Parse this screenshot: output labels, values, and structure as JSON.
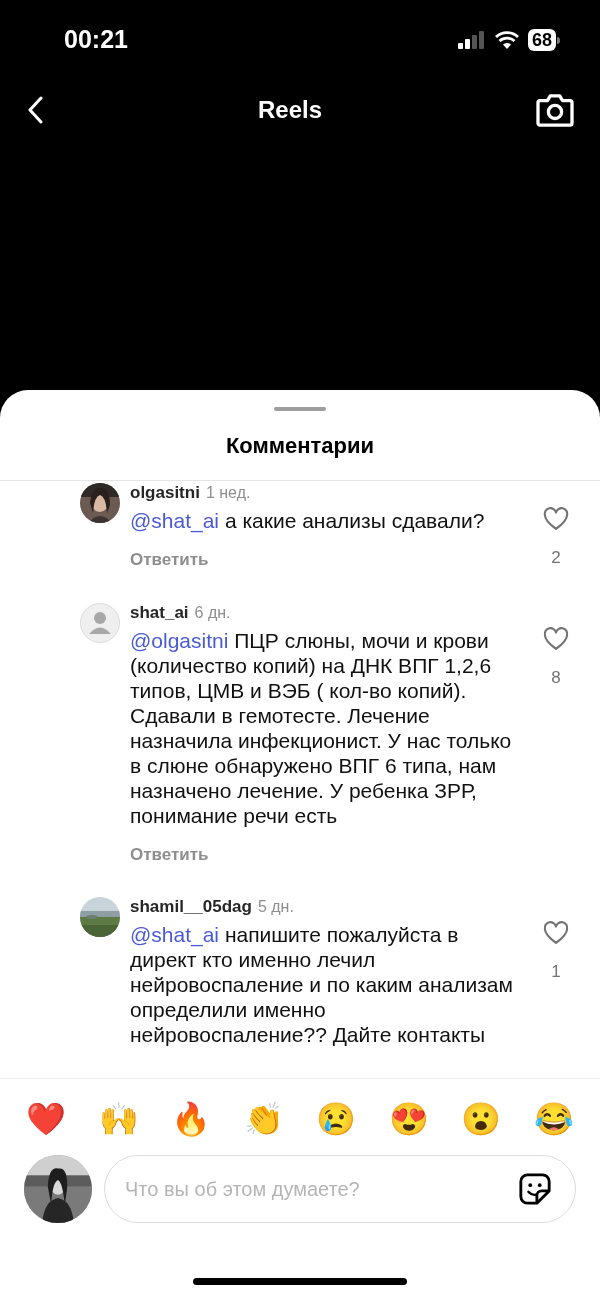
{
  "status_bar": {
    "time": "00:21",
    "battery": "68"
  },
  "header": {
    "title": "Reels"
  },
  "sheet": {
    "title": "Комментарии"
  },
  "comments": [
    {
      "user": "olgasitni",
      "time": "1 нед.",
      "mention": "@shat_ai",
      "text": " а какие анализы сдавали?",
      "reply": "Ответить",
      "likes": "2"
    },
    {
      "avatar": {
        "kind": "default"
      },
      "user": "shat_ai",
      "time": "6 дн.",
      "mention": "@olgasitni",
      "text": " ПЦР слюны, мочи и крови (количество копий) на ДНК ВПГ 1,2,6 типов, ЦМВ и ВЭБ ( кол-во копий). Сдавали в гемотесте. Лечение назначила инфекционист. У нас только в слюне обнаружено ВПГ 6 типа, нам назначено лечение.  У ребенка ЗРР, понимание речи есть",
      "reply": "Ответить",
      "likes": "8"
    },
    {
      "user": "shamil__05dag",
      "time": "5 дн.",
      "mention": "@shat_ai",
      "text": " напишите пожалуйста в директ кто именно лечил нейровоспаление и по каким анализам определили именно нейровоспаление?? Дайте контакты",
      "likes": "1"
    }
  ],
  "reactions": [
    "❤️",
    "🙌",
    "🔥",
    "👏",
    "😢",
    "😍",
    "😮",
    "😂"
  ],
  "composer": {
    "placeholder": "Что вы об этом думаете?"
  }
}
